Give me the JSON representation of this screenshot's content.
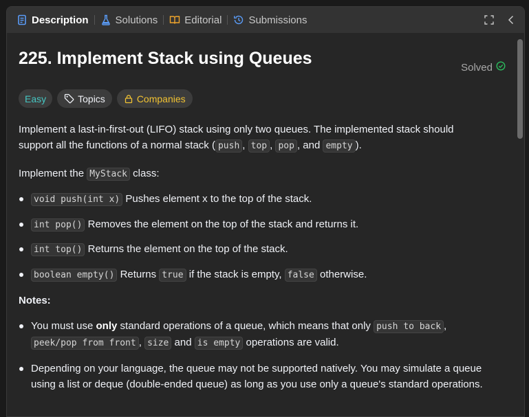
{
  "tabs": [
    {
      "label": "Description",
      "icon": "description-icon",
      "active": true
    },
    {
      "label": "Solutions",
      "icon": "flask-icon"
    },
    {
      "label": "Editorial",
      "icon": "book-icon"
    },
    {
      "label": "Submissions",
      "icon": "history-icon"
    }
  ],
  "problem": {
    "title": "225. Implement Stack using Queues",
    "status": "Solved",
    "difficulty": "Easy",
    "topics_label": "Topics",
    "companies_label": "Companies"
  },
  "description": {
    "intro_a": "Implement a last-in-first-out (LIFO) stack using only two queues. The implemented stack should support all the functions of a normal stack (",
    "intro_code1": "push",
    "intro_sep1": ", ",
    "intro_code2": "top",
    "intro_sep2": ", ",
    "intro_code3": "pop",
    "intro_sep3": ", and ",
    "intro_code4": "empty",
    "intro_end": ").",
    "class_a": "Implement the ",
    "class_code": "MyStack",
    "class_b": " class:",
    "methods": [
      {
        "code": "void push(int x)",
        "text": " Pushes element x to the top of the stack."
      },
      {
        "code": "int pop()",
        "text": " Removes the element on the top of the stack and returns it."
      },
      {
        "code": "int top()",
        "text": " Returns the element on the top of the stack."
      },
      {
        "code": "boolean empty()",
        "text": " Returns "
      }
    ],
    "empty_true": "true",
    "empty_mid": " if the stack is empty, ",
    "empty_false": "false",
    "empty_end": " otherwise.",
    "notes_heading": "Notes:",
    "note1_a": "You must use ",
    "note1_bold": "only",
    "note1_b": " standard operations of a queue, which means that only ",
    "note1_code1": "push to back",
    "note1_c": ",",
    "note1_code2": "peek/pop from front",
    "note1_d": ", ",
    "note1_code3": "size",
    "note1_e": " and ",
    "note1_code4": "is empty",
    "note1_f": " operations are valid.",
    "note2": "Depending on your language, the queue may not be supported natively. You may simulate a queue using a list or deque (double-ended queue) as long as you use only a queue's standard operations."
  }
}
